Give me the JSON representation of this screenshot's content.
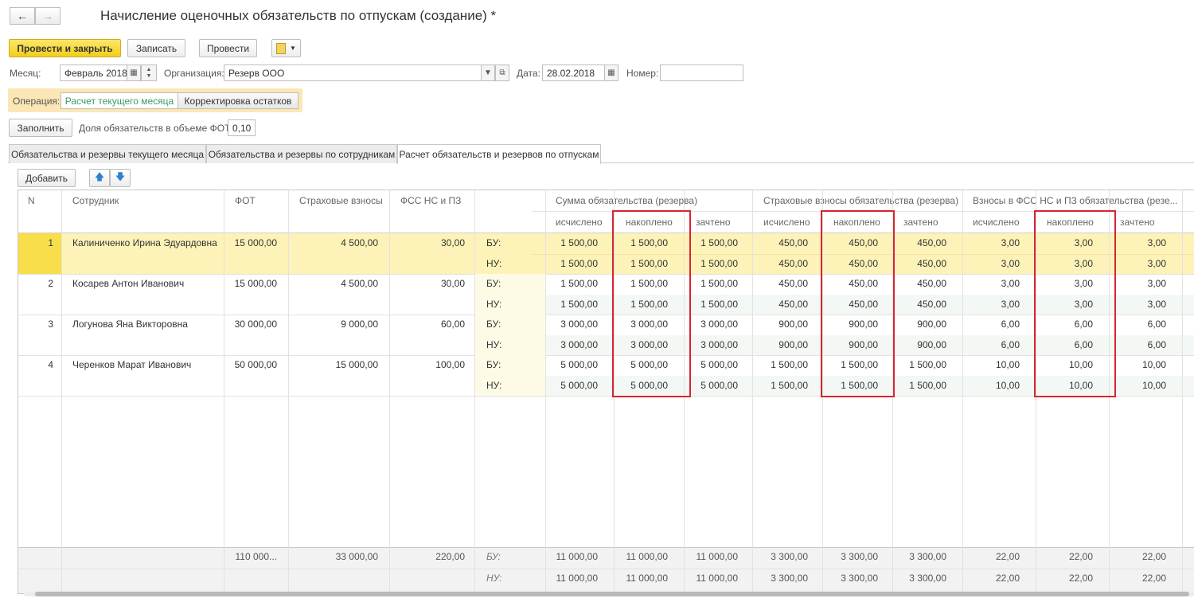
{
  "window": {
    "title": "Начисление оценочных обязательств по отпускам (создание) *",
    "back_icon": "←",
    "forward_icon": "→"
  },
  "toolbar": {
    "post_close": "Провести и закрыть",
    "save": "Записать",
    "post": "Провести",
    "report_icon": "report-icon"
  },
  "form": {
    "month_label": "Месяц:",
    "month_value": "Февраль 2018",
    "org_label": "Организация:",
    "org_value": "Резерв ООО",
    "date_label": "Дата:",
    "date_value": "28.02.2018",
    "number_label": "Номер:",
    "number_value": "",
    "operation_label": "Операция:",
    "operation_options": [
      "Расчет текущего месяца",
      "Корректировка остатков"
    ],
    "fill_button": "Заполнить",
    "share_label": "Доля обязательств в объеме ФОТ:",
    "share_value": "0,10"
  },
  "tabs": [
    "Обязательства и резервы текущего месяца",
    "Обязательства и резервы по сотрудникам",
    "Расчет обязательств и резервов по отпускам"
  ],
  "table_toolbar": {
    "add": "Добавить"
  },
  "table": {
    "headers": {
      "n": "N",
      "employee": "Сотрудник",
      "fot": "ФОТ",
      "insurance": "Страховые взносы",
      "fss": "ФСС НС и ПЗ",
      "group1": "Сумма обязательства (резерва)",
      "group2": "Страховые взносы обязательства (резерва)",
      "group3": "Взносы в ФСС НС и ПЗ обязательства (резе...",
      "accrued": "исчислено",
      "accumulated": "накоплено",
      "credited": "зачтено"
    },
    "rows": [
      {
        "n": "1",
        "name": "Калиниченко Ирина Эдуардовна",
        "fot": "15 000,00",
        "ins": "4 500,00",
        "fss": "30,00",
        "bu_label": "БУ:",
        "nu_label": "НУ:",
        "bu": [
          "1 500,00",
          "1 500,00",
          "1 500,00",
          "450,00",
          "450,00",
          "450,00",
          "3,00",
          "3,00",
          "3,00"
        ],
        "nu": [
          "1 500,00",
          "1 500,00",
          "1 500,00",
          "450,00",
          "450,00",
          "450,00",
          "3,00",
          "3,00",
          "3,00"
        ]
      },
      {
        "n": "2",
        "name": "Косарев Антон Иванович",
        "fot": "15 000,00",
        "ins": "4 500,00",
        "fss": "30,00",
        "bu_label": "БУ:",
        "nu_label": "НУ:",
        "bu": [
          "1 500,00",
          "1 500,00",
          "1 500,00",
          "450,00",
          "450,00",
          "450,00",
          "3,00",
          "3,00",
          "3,00"
        ],
        "nu": [
          "1 500,00",
          "1 500,00",
          "1 500,00",
          "450,00",
          "450,00",
          "450,00",
          "3,00",
          "3,00",
          "3,00"
        ]
      },
      {
        "n": "3",
        "name": "Логунова Яна Викторовна",
        "fot": "30 000,00",
        "ins": "9 000,00",
        "fss": "60,00",
        "bu_label": "БУ:",
        "nu_label": "НУ:",
        "bu": [
          "3 000,00",
          "3 000,00",
          "3 000,00",
          "900,00",
          "900,00",
          "900,00",
          "6,00",
          "6,00",
          "6,00"
        ],
        "nu": [
          "3 000,00",
          "3 000,00",
          "3 000,00",
          "900,00",
          "900,00",
          "900,00",
          "6,00",
          "6,00",
          "6,00"
        ]
      },
      {
        "n": "4",
        "name": "Черенков Марат Иванович",
        "fot": "50 000,00",
        "ins": "15 000,00",
        "fss": "100,00",
        "bu_label": "БУ:",
        "nu_label": "НУ:",
        "bu": [
          "5 000,00",
          "5 000,00",
          "5 000,00",
          "1 500,00",
          "1 500,00",
          "1 500,00",
          "10,00",
          "10,00",
          "10,00"
        ],
        "nu": [
          "5 000,00",
          "5 000,00",
          "5 000,00",
          "1 500,00",
          "1 500,00",
          "1 500,00",
          "10,00",
          "10,00",
          "10,00"
        ]
      }
    ],
    "totals": {
      "fot": "110 000...",
      "ins": "33 000,00",
      "fss": "220,00",
      "bu_label": "БУ:",
      "nu_label": "НУ:",
      "bu": [
        "11 000,00",
        "11 000,00",
        "11 000,00",
        "3 300,00",
        "3 300,00",
        "3 300,00",
        "22,00",
        "22,00",
        "22,00"
      ],
      "nu": [
        "11 000,00",
        "11 000,00",
        "11 000,00",
        "3 300,00",
        "3 300,00",
        "3 300,00",
        "22,00",
        "22,00",
        "22,00"
      ]
    }
  },
  "colors": {
    "primary_button": "#f2cd1c",
    "selected_row": "#fdf3b8",
    "selected_cell": "#f8df4a",
    "highlight_box": "#d8262f",
    "operation_bar": "#fbe7b5"
  }
}
